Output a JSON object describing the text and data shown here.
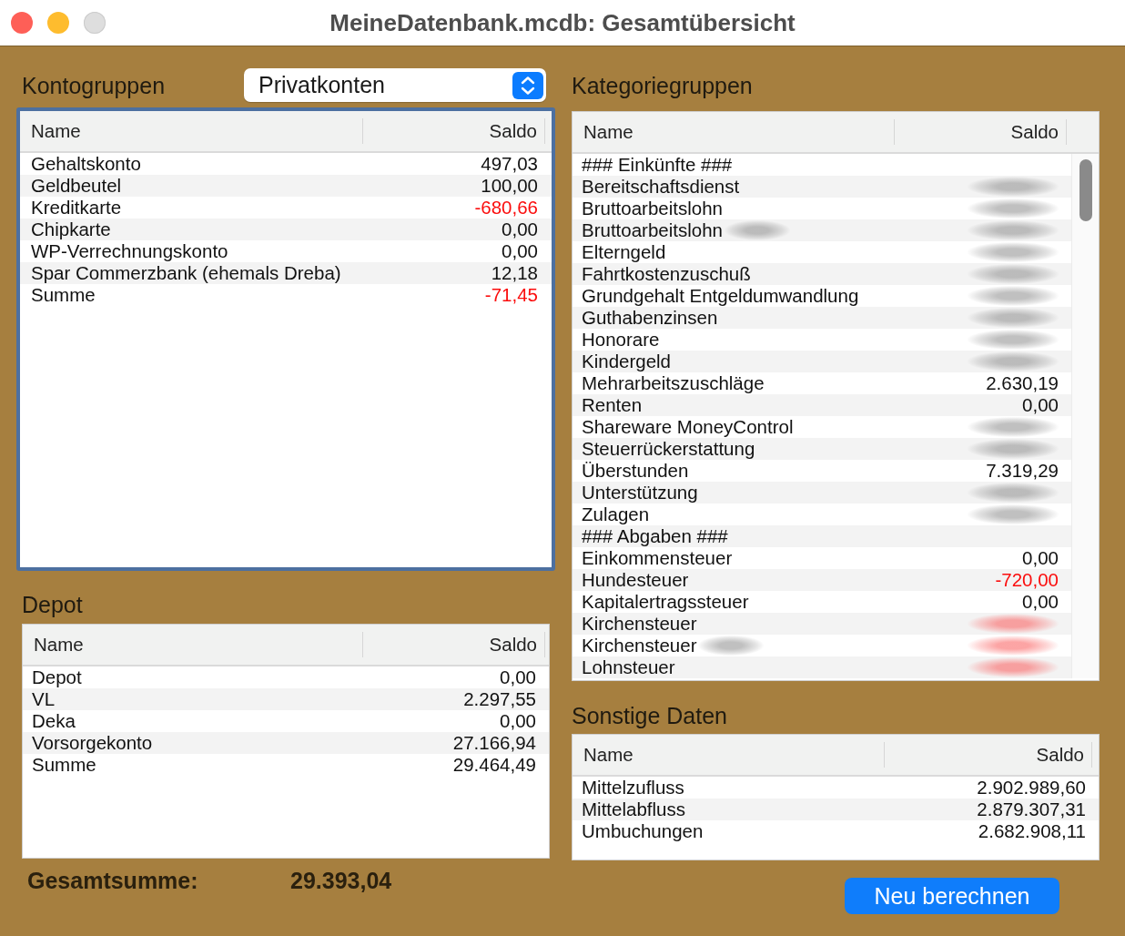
{
  "window": {
    "title": "MeineDatenbank.mcdb: Gesamtübersicht",
    "controls": [
      {
        "kind": "close",
        "disabled": false
      },
      {
        "kind": "minimize",
        "disabled": false
      },
      {
        "kind": "zoom",
        "disabled": true
      }
    ]
  },
  "kontogruppen": {
    "label": "Kontogruppen",
    "selector": {
      "value": "Privatkonten"
    },
    "focused": true,
    "columns": [
      "Name",
      "Saldo"
    ],
    "rows": [
      {
        "name": "Gehaltskonto",
        "saldo": "497,03",
        "negative": false
      },
      {
        "name": "Geldbeutel",
        "saldo": "100,00",
        "negative": false
      },
      {
        "name": "Kreditkarte",
        "saldo": "-680,66",
        "negative": true
      },
      {
        "name": "Chipkarte",
        "saldo": "0,00",
        "negative": false
      },
      {
        "name": "WP-Verrechnungskonto",
        "saldo": "0,00",
        "negative": false
      },
      {
        "name": "Spar Commerzbank (ehemals Dreba)",
        "saldo": "12,18",
        "negative": false
      },
      {
        "name": "Summe",
        "saldo": "-71,45",
        "negative": true
      }
    ]
  },
  "depot": {
    "label": "Depot",
    "focused": false,
    "columns": [
      "Name",
      "Saldo"
    ],
    "rows": [
      {
        "name": "Depot",
        "saldo": "0,00",
        "negative": false
      },
      {
        "name": "VL",
        "saldo": "2.297,55",
        "negative": false
      },
      {
        "name": "Deka",
        "saldo": "0,00",
        "negative": false
      },
      {
        "name": "Vorsorgekonto",
        "saldo": "27.166,94",
        "negative": false
      },
      {
        "name": "Summe",
        "saldo": "29.464,49",
        "negative": false
      }
    ]
  },
  "gesamtsumme": {
    "label": "Gesamtsumme:",
    "value": "29.393,04"
  },
  "kategoriegruppen": {
    "label": "Kategoriegruppen",
    "focused": false,
    "scrollbar": true,
    "columns": [
      "Name",
      "Saldo"
    ],
    "rows": [
      {
        "name": "### Einkünfte ###",
        "name_blurred": false
      },
      {
        "name": "Bereitschaftsdienst",
        "name_blurred": false,
        "saldo_blurred": true,
        "negative": false
      },
      {
        "name": "Bruttoarbeitslohn",
        "name_blurred": false,
        "saldo_blurred": true,
        "negative": false
      },
      {
        "name": "Bruttoarbeitslohn",
        "name_blurred": true,
        "saldo_blurred": true,
        "negative": false
      },
      {
        "name": "Elterngeld",
        "name_blurred": false,
        "saldo_blurred": true,
        "negative": false
      },
      {
        "name": "Fahrtkostenzuschuß",
        "name_blurred": false,
        "saldo_blurred": true,
        "negative": false
      },
      {
        "name": "Grundgehalt Entgeldumwandlung",
        "name_blurred": false,
        "saldo_blurred": true,
        "negative": false
      },
      {
        "name": "Guthabenzinsen",
        "name_blurred": false,
        "saldo_blurred": true,
        "negative": false
      },
      {
        "name": "Honorare",
        "name_blurred": false,
        "saldo_blurred": true,
        "negative": false
      },
      {
        "name": "Kindergeld",
        "name_blurred": false,
        "saldo_blurred": true,
        "negative": false
      },
      {
        "name": "Mehrarbeitszuschläge",
        "name_blurred": false,
        "saldo": "2.630,19",
        "saldo_blurred": false,
        "negative": false
      },
      {
        "name": "Renten",
        "name_blurred": false,
        "saldo": "0,00",
        "saldo_blurred": false,
        "negative": false
      },
      {
        "name": "Shareware MoneyControl",
        "name_blurred": false,
        "saldo_blurred": true,
        "negative": false
      },
      {
        "name": "Steuerrückerstattung",
        "name_blurred": false,
        "saldo_blurred": true,
        "negative": false
      },
      {
        "name": "Überstunden",
        "name_blurred": false,
        "saldo": "7.319,29",
        "saldo_blurred": false,
        "negative": false
      },
      {
        "name": "Unterstützung",
        "name_blurred": false,
        "saldo_blurred": true,
        "negative": false
      },
      {
        "name": "Zulagen",
        "name_blurred": false,
        "saldo_blurred": true,
        "negative": false
      },
      {
        "name": "### Abgaben ###",
        "name_blurred": false
      },
      {
        "name": "Einkommensteuer",
        "name_blurred": false,
        "saldo": "0,00",
        "saldo_blurred": false,
        "negative": false
      },
      {
        "name": "Hundesteuer",
        "name_blurred": false,
        "saldo": "-720,00",
        "saldo_blurred": false,
        "negative": true
      },
      {
        "name": "Kapitalertragssteuer",
        "name_blurred": false,
        "saldo": "0,00",
        "saldo_blurred": false,
        "negative": false
      },
      {
        "name": "Kirchensteuer",
        "name_blurred": false,
        "saldo_blurred": true,
        "negative": true
      },
      {
        "name": "Kirchensteuer",
        "name_blurred": true,
        "saldo_blurred": true,
        "negative": true
      },
      {
        "name": "Lohnsteuer",
        "name_blurred": false,
        "saldo_blurred": true,
        "negative": true
      }
    ]
  },
  "sonstige_daten": {
    "label": "Sonstige Daten",
    "focused": false,
    "columns": [
      "Name",
      "Saldo"
    ],
    "rows": [
      {
        "name": "Mittelzufluss",
        "saldo": "2.902.989,60",
        "negative": false
      },
      {
        "name": "Mittelabfluss",
        "saldo": "2.879.307,31",
        "negative": false
      },
      {
        "name": "Umbuchungen",
        "saldo": "2.682.908,11",
        "negative": false
      }
    ]
  },
  "button": {
    "label": "Neu berechnen"
  }
}
